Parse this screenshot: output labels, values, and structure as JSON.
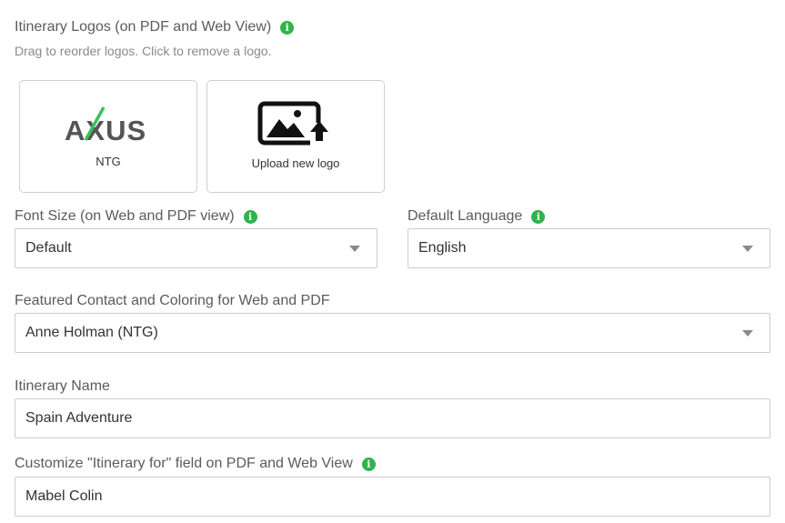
{
  "logos": {
    "label": "Itinerary Logos (on PDF and Web View)",
    "hint": "Drag to reorder logos. Click to remove a logo.",
    "items": [
      {
        "logo_text": "AXUS",
        "caption": "NTG",
        "logo_icon": "axus-logo"
      },
      {
        "caption": "Upload new logo",
        "icon": "image-upload-icon"
      }
    ]
  },
  "font_size": {
    "label": "Font Size (on Web and PDF view)",
    "value": "Default"
  },
  "default_language": {
    "label": "Default Language",
    "value": "English"
  },
  "featured_contact": {
    "label": "Featured Contact and Coloring for Web and PDF",
    "value": "Anne Holman (NTG)"
  },
  "itinerary_name": {
    "label": "Itinerary Name",
    "value": "Spain Adventure"
  },
  "itinerary_for": {
    "label": "Customize \"Itinerary for\" field on PDF and Web View",
    "value": "Mabel Colin"
  },
  "colors": {
    "info_icon": "#2fb34a",
    "axus_slash": "#3cc05a",
    "border": "#cccccc"
  }
}
